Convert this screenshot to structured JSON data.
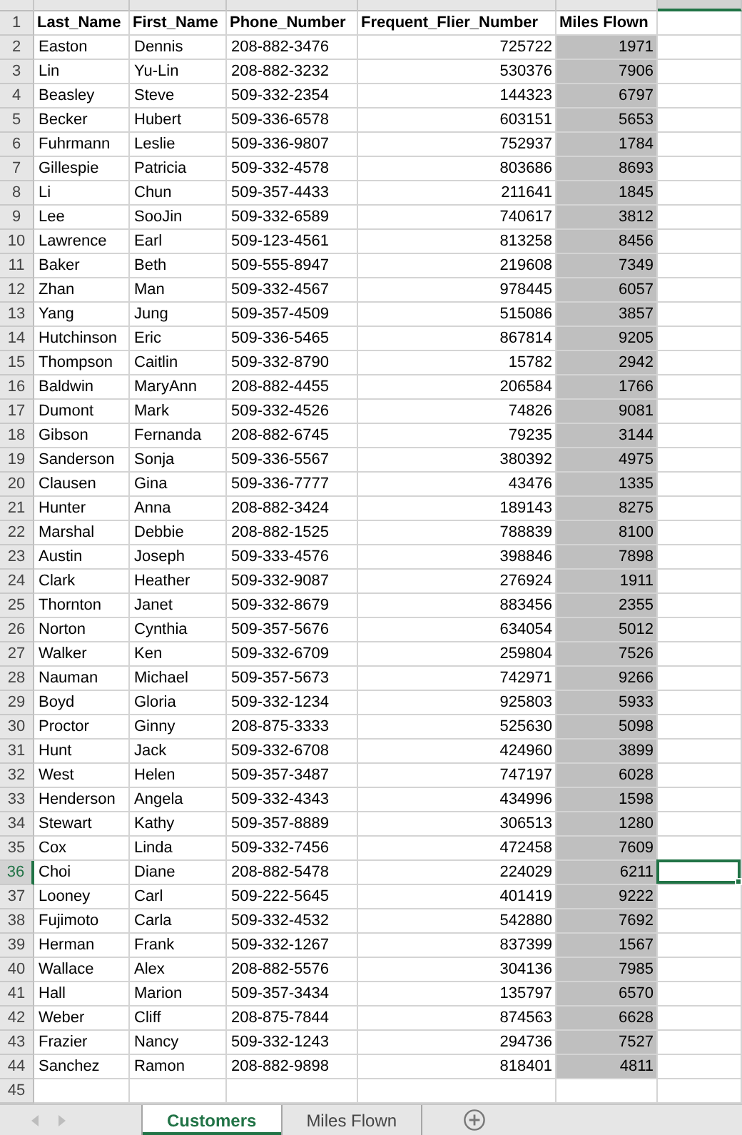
{
  "columns": [
    {
      "header": "Last_Name",
      "kind": "text",
      "shaded": false
    },
    {
      "header": "First_Name",
      "kind": "text",
      "shaded": false
    },
    {
      "header": "Phone_Number",
      "kind": "text",
      "shaded": false
    },
    {
      "header": "Frequent_Flier_Number",
      "kind": "number",
      "shaded": false
    },
    {
      "header": "Miles Flown",
      "kind": "number",
      "shaded": true
    }
  ],
  "header_row_number": "1",
  "rows": [
    {
      "number": "2",
      "selected": false,
      "cells": [
        "Easton",
        "Dennis",
        "208-882-3476",
        "725722",
        "1971"
      ]
    },
    {
      "number": "3",
      "selected": false,
      "cells": [
        "Lin",
        "Yu-Lin",
        "208-882-3232",
        "530376",
        "7906"
      ]
    },
    {
      "number": "4",
      "selected": false,
      "cells": [
        "Beasley",
        "Steve",
        "509-332-2354",
        "144323",
        "6797"
      ]
    },
    {
      "number": "5",
      "selected": false,
      "cells": [
        "Becker",
        "Hubert",
        "509-336-6578",
        "603151",
        "5653"
      ]
    },
    {
      "number": "6",
      "selected": false,
      "cells": [
        "Fuhrmann",
        "Leslie",
        "509-336-9807",
        "752937",
        "1784"
      ]
    },
    {
      "number": "7",
      "selected": false,
      "cells": [
        "Gillespie",
        "Patricia",
        "509-332-4578",
        "803686",
        "8693"
      ]
    },
    {
      "number": "8",
      "selected": false,
      "cells": [
        "Li",
        "Chun",
        "509-357-4433",
        "211641",
        "1845"
      ]
    },
    {
      "number": "9",
      "selected": false,
      "cells": [
        "Lee",
        "SooJin",
        "509-332-6589",
        "740617",
        "3812"
      ]
    },
    {
      "number": "10",
      "selected": false,
      "cells": [
        "Lawrence",
        "Earl",
        "509-123-4561",
        "813258",
        "8456"
      ]
    },
    {
      "number": "11",
      "selected": false,
      "cells": [
        "Baker",
        "Beth",
        "509-555-8947",
        "219608",
        "7349"
      ]
    },
    {
      "number": "12",
      "selected": false,
      "cells": [
        "Zhan",
        "Man",
        "509-332-4567",
        "978445",
        "6057"
      ]
    },
    {
      "number": "13",
      "selected": false,
      "cells": [
        "Yang",
        "Jung",
        "509-357-4509",
        "515086",
        "3857"
      ]
    },
    {
      "number": "14",
      "selected": false,
      "cells": [
        "Hutchinson",
        "Eric",
        "509-336-5465",
        "867814",
        "9205"
      ]
    },
    {
      "number": "15",
      "selected": false,
      "cells": [
        "Thompson",
        "Caitlin",
        "509-332-8790",
        "15782",
        "2942"
      ]
    },
    {
      "number": "16",
      "selected": false,
      "cells": [
        "Baldwin",
        "MaryAnn",
        "208-882-4455",
        "206584",
        "1766"
      ]
    },
    {
      "number": "17",
      "selected": false,
      "cells": [
        "Dumont",
        "Mark",
        "509-332-4526",
        "74826",
        "9081"
      ]
    },
    {
      "number": "18",
      "selected": false,
      "cells": [
        "Gibson",
        "Fernanda",
        "208-882-6745",
        "79235",
        "3144"
      ]
    },
    {
      "number": "19",
      "selected": false,
      "cells": [
        "Sanderson",
        "Sonja",
        "509-336-5567",
        "380392",
        "4975"
      ]
    },
    {
      "number": "20",
      "selected": false,
      "cells": [
        "Clausen",
        "Gina",
        "509-336-7777",
        "43476",
        "1335"
      ]
    },
    {
      "number": "21",
      "selected": false,
      "cells": [
        "Hunter",
        "Anna",
        "208-882-3424",
        "189143",
        "8275"
      ]
    },
    {
      "number": "22",
      "selected": false,
      "cells": [
        "Marshal",
        "Debbie",
        "208-882-1525",
        "788839",
        "8100"
      ]
    },
    {
      "number": "23",
      "selected": false,
      "cells": [
        "Austin",
        "Joseph",
        "509-333-4576",
        "398846",
        "7898"
      ]
    },
    {
      "number": "24",
      "selected": false,
      "cells": [
        "Clark",
        "Heather",
        "509-332-9087",
        "276924",
        "1911"
      ]
    },
    {
      "number": "25",
      "selected": false,
      "cells": [
        "Thornton",
        "Janet",
        "509-332-8679",
        "883456",
        "2355"
      ]
    },
    {
      "number": "26",
      "selected": false,
      "cells": [
        "Norton",
        "Cynthia",
        "509-357-5676",
        "634054",
        "5012"
      ]
    },
    {
      "number": "27",
      "selected": false,
      "cells": [
        "Walker",
        "Ken",
        "509-332-6709",
        "259804",
        "7526"
      ]
    },
    {
      "number": "28",
      "selected": false,
      "cells": [
        "Nauman",
        "Michael",
        "509-357-5673",
        "742971",
        "9266"
      ]
    },
    {
      "number": "29",
      "selected": false,
      "cells": [
        "Boyd",
        "Gloria",
        "509-332-1234",
        "925803",
        "5933"
      ]
    },
    {
      "number": "30",
      "selected": false,
      "cells": [
        "Proctor",
        "Ginny",
        "208-875-3333",
        "525630",
        "5098"
      ]
    },
    {
      "number": "31",
      "selected": false,
      "cells": [
        "Hunt",
        "Jack",
        "509-332-6708",
        "424960",
        "3899"
      ]
    },
    {
      "number": "32",
      "selected": false,
      "cells": [
        "West",
        "Helen",
        "509-357-3487",
        "747197",
        "6028"
      ]
    },
    {
      "number": "33",
      "selected": false,
      "cells": [
        "Henderson",
        "Angela",
        "509-332-4343",
        "434996",
        "1598"
      ]
    },
    {
      "number": "34",
      "selected": false,
      "cells": [
        "Stewart",
        "Kathy",
        "509-357-8889",
        "306513",
        "1280"
      ]
    },
    {
      "number": "35",
      "selected": false,
      "cells": [
        "Cox",
        "Linda",
        "509-332-7456",
        "472458",
        "7609"
      ]
    },
    {
      "number": "36",
      "selected": true,
      "cells": [
        "Choi",
        "Diane",
        "208-882-5478",
        "224029",
        "6211"
      ]
    },
    {
      "number": "37",
      "selected": false,
      "cells": [
        "Looney",
        "Carl",
        "509-222-5645",
        "401419",
        "9222"
      ]
    },
    {
      "number": "38",
      "selected": false,
      "cells": [
        "Fujimoto",
        "Carla",
        "509-332-4532",
        "542880",
        "7692"
      ]
    },
    {
      "number": "39",
      "selected": false,
      "cells": [
        "Herman",
        "Frank",
        "509-332-1267",
        "837399",
        "1567"
      ]
    },
    {
      "number": "40",
      "selected": false,
      "cells": [
        "Wallace",
        "Alex",
        "208-882-5576",
        "304136",
        "7985"
      ]
    },
    {
      "number": "41",
      "selected": false,
      "cells": [
        "Hall",
        "Marion",
        "509-357-3434",
        "135797",
        "6570"
      ]
    },
    {
      "number": "42",
      "selected": false,
      "cells": [
        "Weber",
        "Cliff",
        "208-875-7844",
        "874563",
        "6628"
      ]
    },
    {
      "number": "43",
      "selected": false,
      "cells": [
        "Frazier",
        "Nancy",
        "509-332-1243",
        "294736",
        "7527"
      ]
    },
    {
      "number": "44",
      "selected": false,
      "cells": [
        "Sanchez",
        "Ramon",
        "208-882-9898",
        "818401",
        "4811"
      ]
    },
    {
      "number": "45",
      "selected": false
    }
  ],
  "sheet_tabs": [
    {
      "label": "Customers",
      "selected": true
    },
    {
      "label": "Miles Flown",
      "selected": false
    }
  ]
}
